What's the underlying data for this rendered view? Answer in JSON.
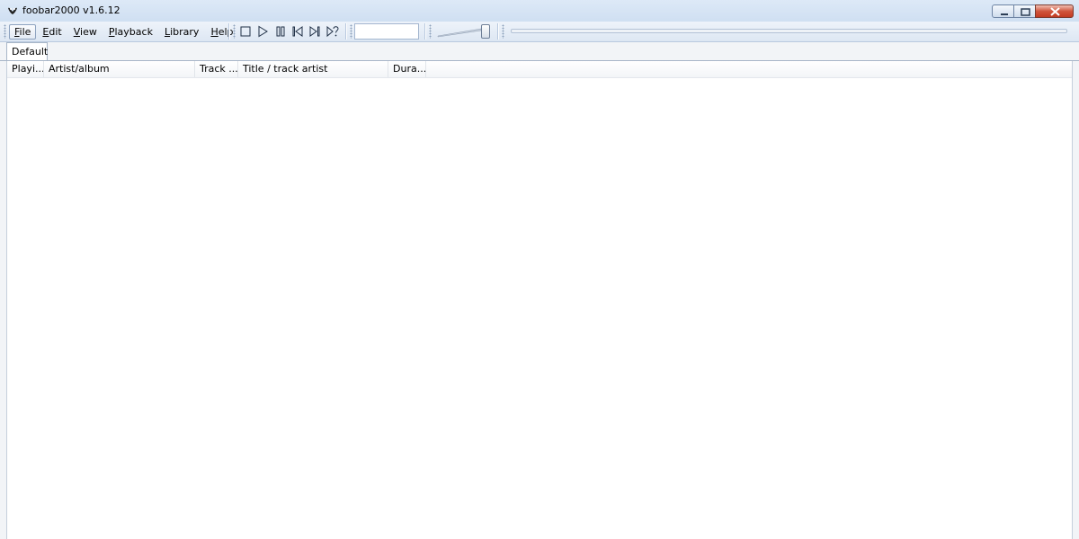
{
  "window": {
    "title": "foobar2000 v1.6.12",
    "icons": {
      "app": "foobar-icon",
      "minimize": "minimize-icon",
      "maximize": "restore-icon",
      "close": "close-icon"
    }
  },
  "menu": [
    {
      "label": "File",
      "accel": "F",
      "rest": "ile"
    },
    {
      "label": "Edit",
      "accel": "E",
      "rest": "dit"
    },
    {
      "label": "View",
      "accel": "V",
      "rest": "iew"
    },
    {
      "label": "Playback",
      "accel": "P",
      "rest": "layback"
    },
    {
      "label": "Library",
      "accel": "L",
      "rest": "ibrary"
    },
    {
      "label": "Help",
      "accel": "H",
      "rest": "elp"
    }
  ],
  "toolbar": {
    "buttons": [
      "stop-icon",
      "play-icon",
      "pause-icon",
      "previous-icon",
      "next-icon",
      "random-icon"
    ]
  },
  "tabs": [
    {
      "label": "Default"
    }
  ],
  "playlist": {
    "columns": [
      {
        "label": "Playi..."
      },
      {
        "label": "Artist/album"
      },
      {
        "label": "Track ..."
      },
      {
        "label": "Title / track artist"
      },
      {
        "label": "Dura..."
      }
    ]
  },
  "colors": {
    "accent": "#dce7f4",
    "close": "#c23b22"
  }
}
